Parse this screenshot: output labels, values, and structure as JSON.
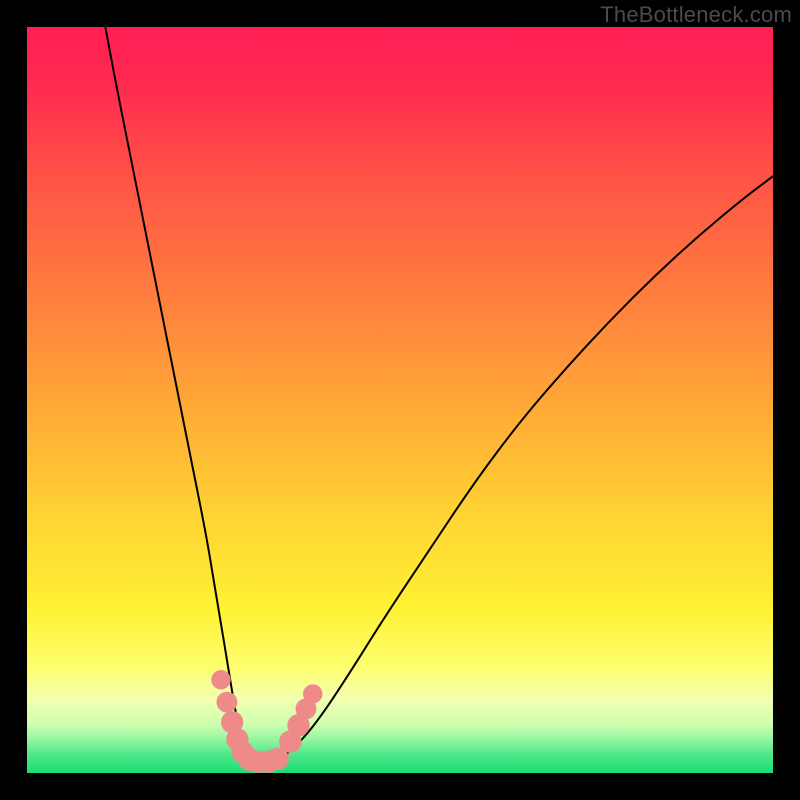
{
  "watermark": "TheBottleneck.com",
  "chart_data": {
    "type": "line",
    "title": "",
    "xlabel": "",
    "ylabel": "",
    "xlim": [
      0,
      100
    ],
    "ylim": [
      0,
      100
    ],
    "background_gradient": {
      "stops": [
        {
          "offset": 0.0,
          "color": "#ff1f55"
        },
        {
          "offset": 0.08,
          "color": "#ff2b4f"
        },
        {
          "offset": 0.2,
          "color": "#ff5246"
        },
        {
          "offset": 0.35,
          "color": "#ff7b3e"
        },
        {
          "offset": 0.5,
          "color": "#ffa637"
        },
        {
          "offset": 0.65,
          "color": "#ffd233"
        },
        {
          "offset": 0.78,
          "color": "#fff133"
        },
        {
          "offset": 0.86,
          "color": "#fdff70"
        },
        {
          "offset": 0.9,
          "color": "#f4ffb0"
        },
        {
          "offset": 0.935,
          "color": "#ceffb0"
        },
        {
          "offset": 0.955,
          "color": "#95f6a0"
        },
        {
          "offset": 0.975,
          "color": "#4fe889"
        },
        {
          "offset": 1.0,
          "color": "#17df74"
        }
      ]
    },
    "series": [
      {
        "name": "curve",
        "stroke": "#000000",
        "stroke_width": 2,
        "x": [
          10.5,
          12,
          14,
          16,
          18,
          20,
          22,
          24,
          25,
          26,
          27,
          27.8,
          28.5,
          29.2,
          30,
          31,
          32.5,
          34,
          36,
          39,
          43,
          48,
          54,
          60,
          66,
          72,
          78,
          84,
          90,
          96,
          100
        ],
        "y": [
          100,
          92,
          82,
          72,
          62,
          52,
          42,
          32,
          26,
          20,
          14,
          9,
          5.5,
          3.2,
          2.0,
          1.5,
          1.5,
          2.0,
          3.5,
          7,
          13,
          21,
          30,
          39,
          47,
          54,
          60.5,
          66.5,
          72,
          77,
          80
        ]
      }
    ],
    "markers": {
      "name": "highlight-beads",
      "fill": "#ef8a8a",
      "points": [
        {
          "x": 26.0,
          "y": 12.5,
          "r": 1.3
        },
        {
          "x": 26.8,
          "y": 9.5,
          "r": 1.4
        },
        {
          "x": 27.5,
          "y": 6.8,
          "r": 1.5
        },
        {
          "x": 28.2,
          "y": 4.5,
          "r": 1.5
        },
        {
          "x": 28.9,
          "y": 2.8,
          "r": 1.5
        },
        {
          "x": 29.8,
          "y": 1.8,
          "r": 1.5
        },
        {
          "x": 31.0,
          "y": 1.5,
          "r": 1.5
        },
        {
          "x": 32.3,
          "y": 1.5,
          "r": 1.5
        },
        {
          "x": 33.6,
          "y": 1.9,
          "r": 1.5
        },
        {
          "x": 35.3,
          "y": 4.2,
          "r": 1.5
        },
        {
          "x": 36.4,
          "y": 6.4,
          "r": 1.5
        },
        {
          "x": 37.4,
          "y": 8.6,
          "r": 1.4
        },
        {
          "x": 38.3,
          "y": 10.6,
          "r": 1.3
        }
      ]
    }
  }
}
